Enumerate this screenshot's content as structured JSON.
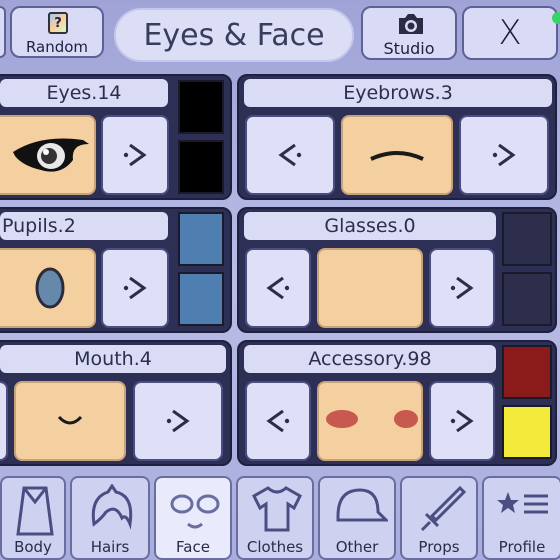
{
  "header": {
    "random_label": "Random",
    "title": "Eyes & Face",
    "studio_label": "Studio",
    "close_label": "X"
  },
  "features": [
    {
      "label": "Eyes.14",
      "swatches": [
        "#000000",
        "#000000"
      ]
    },
    {
      "label": "Eyebrows.3"
    },
    {
      "label": "Pupils.2",
      "swatches": [
        "#4f7fb0",
        "#4f7fb0"
      ]
    },
    {
      "label": "Glasses.0",
      "swatches": [
        "#2c2e4c",
        "#2c2e4c"
      ]
    },
    {
      "label": "Mouth.4"
    },
    {
      "label": "Accessory.98",
      "swatches": [
        "#8b1a1a",
        "#f3ea3c"
      ]
    }
  ],
  "arrows": {
    "prev": "<",
    "next": ">"
  },
  "nav": [
    {
      "label": "Body",
      "icon": "body-icon"
    },
    {
      "label": "Hairs",
      "icon": "hair-icon"
    },
    {
      "label": "Face",
      "icon": "face-icon",
      "active": true
    },
    {
      "label": "Clothes",
      "icon": "shirt-icon"
    },
    {
      "label": "Other",
      "icon": "cap-icon"
    },
    {
      "label": "Props",
      "icon": "sword-icon"
    },
    {
      "label": "Profile",
      "icon": "profile-icon"
    }
  ],
  "colors": {
    "accent": "#4b4e82",
    "skin": "#f4cf9f",
    "status_dot": "#39d36b"
  }
}
